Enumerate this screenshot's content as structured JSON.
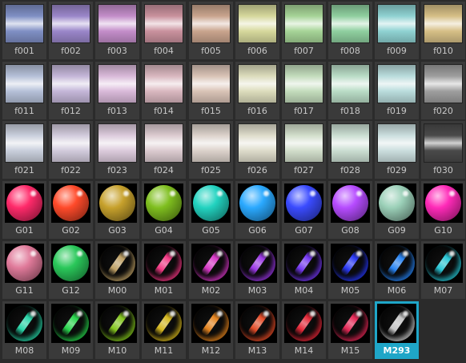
{
  "materials": [
    {
      "label": "f001",
      "kind": "flat",
      "color": "#7f8fc4"
    },
    {
      "label": "f002",
      "kind": "flat",
      "color": "#9a86c9"
    },
    {
      "label": "f003",
      "kind": "flat",
      "color": "#c38dc9"
    },
    {
      "label": "f004",
      "kind": "flat",
      "color": "#c9919d"
    },
    {
      "label": "f005",
      "kind": "flat",
      "color": "#c9a48d"
    },
    {
      "label": "f006",
      "kind": "flat",
      "color": "#d6d89c"
    },
    {
      "label": "f007",
      "kind": "flat",
      "color": "#a6d497"
    },
    {
      "label": "f008",
      "kind": "flat",
      "color": "#8fcf9f"
    },
    {
      "label": "f009",
      "kind": "flat",
      "color": "#8fd2d2"
    },
    {
      "label": "f010",
      "kind": "flat",
      "color": "#d6bf86"
    },
    {
      "label": "f011",
      "kind": "flat",
      "color": "#b5c0d8"
    },
    {
      "label": "f012",
      "kind": "flat",
      "color": "#c4b6d8"
    },
    {
      "label": "f013",
      "kind": "flat",
      "color": "#d9b9d9"
    },
    {
      "label": "f014",
      "kind": "flat",
      "color": "#d9b7bf"
    },
    {
      "label": "f015",
      "kind": "flat",
      "color": "#d9c3b6"
    },
    {
      "label": "f016",
      "kind": "flat",
      "color": "#dcdcbc"
    },
    {
      "label": "f017",
      "kind": "flat",
      "color": "#c3dcbc"
    },
    {
      "label": "f018",
      "kind": "flat",
      "color": "#b9dcc6"
    },
    {
      "label": "f019",
      "kind": "flat",
      "color": "#b9dcdc"
    },
    {
      "label": "f020",
      "kind": "flat",
      "color": "#9e9e9e"
    },
    {
      "label": "f021",
      "kind": "flat",
      "color": "#c9cfdc"
    },
    {
      "label": "f022",
      "kind": "flat",
      "color": "#d2cbdc"
    },
    {
      "label": "f023",
      "kind": "flat",
      "color": "#dccbdc"
    },
    {
      "label": "f024",
      "kind": "flat",
      "color": "#dccbd0"
    },
    {
      "label": "f025",
      "kind": "flat",
      "color": "#dcd2cb"
    },
    {
      "label": "f026",
      "kind": "flat",
      "color": "#dedccb"
    },
    {
      "label": "f027",
      "kind": "flat",
      "color": "#d2decb"
    },
    {
      "label": "f028",
      "kind": "flat",
      "color": "#cbded2"
    },
    {
      "label": "f029",
      "kind": "flat",
      "color": "#cbdede"
    },
    {
      "label": "f030",
      "kind": "flat",
      "color": "#4a4a4a"
    },
    {
      "label": "G01",
      "kind": "glossy",
      "color": "#ff2a6a"
    },
    {
      "label": "G02",
      "kind": "glossy",
      "color": "#ff4a2a"
    },
    {
      "label": "G03",
      "kind": "glossy",
      "color": "#c7a12c"
    },
    {
      "label": "G04",
      "kind": "glossy",
      "color": "#7fbf1f"
    },
    {
      "label": "G05",
      "kind": "glossy",
      "color": "#22d3c0"
    },
    {
      "label": "G06",
      "kind": "glossy",
      "color": "#2aa9ff"
    },
    {
      "label": "G07",
      "kind": "glossy",
      "color": "#3a4bff"
    },
    {
      "label": "G08",
      "kind": "glossy",
      "color": "#b64bff"
    },
    {
      "label": "G09",
      "kind": "glossy",
      "color": "#9bd0b8"
    },
    {
      "label": "G10",
      "kind": "glossy",
      "color": "#ff2ab8"
    },
    {
      "label": "G11",
      "kind": "glossy",
      "color": "#e07a9a"
    },
    {
      "label": "G12",
      "kind": "glossy",
      "color": "#2ac85a"
    },
    {
      "label": "M00",
      "kind": "metal",
      "color": "#c8a86a"
    },
    {
      "label": "M01",
      "kind": "metal",
      "color": "#ff3a8a"
    },
    {
      "label": "M02",
      "kind": "metal",
      "color": "#e23ad0"
    },
    {
      "label": "M03",
      "kind": "metal",
      "color": "#a23af0"
    },
    {
      "label": "M04",
      "kind": "metal",
      "color": "#7a3aff"
    },
    {
      "label": "M05",
      "kind": "metal",
      "color": "#2a3aff"
    },
    {
      "label": "M06",
      "kind": "metal",
      "color": "#2a8aff"
    },
    {
      "label": "M07",
      "kind": "metal",
      "color": "#2ad0e0"
    },
    {
      "label": "M08",
      "kind": "metal",
      "color": "#2ae0b0"
    },
    {
      "label": "M09",
      "kind": "metal",
      "color": "#2ae050"
    },
    {
      "label": "M10",
      "kind": "metal",
      "color": "#8ad020"
    },
    {
      "label": "M11",
      "kind": "metal",
      "color": "#e0c020"
    },
    {
      "label": "M12",
      "kind": "metal",
      "color": "#f08a20"
    },
    {
      "label": "M13",
      "kind": "metal",
      "color": "#f0502a"
    },
    {
      "label": "M14",
      "kind": "metal",
      "color": "#f02a3a"
    },
    {
      "label": "M15",
      "kind": "metal",
      "color": "#f02a5a"
    },
    {
      "label": "M293",
      "kind": "metal",
      "color": "#d0d0d0",
      "selected": true
    }
  ],
  "colors": {
    "background": "#2b2b2b",
    "cell": "#3a3a3a",
    "selected": "#1fa6c8",
    "label": "#c8c8c8"
  }
}
